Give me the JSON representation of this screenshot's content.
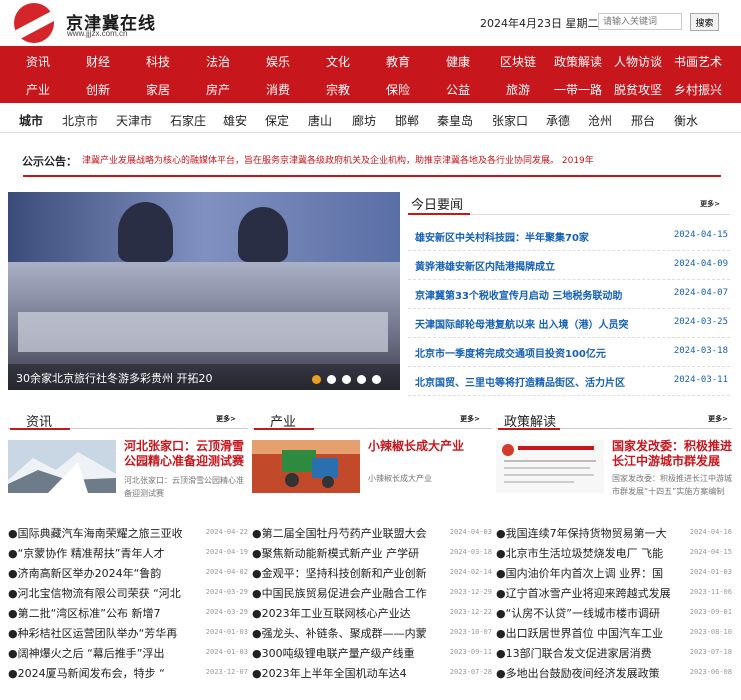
{
  "header": {
    "site_name": "京津冀在线",
    "site_url": "www.jjjzx.com.cn",
    "date": "2024年4月23日 星期二",
    "search_placeholder": "请输入关键词",
    "search_button": "搜索"
  },
  "nav": {
    "row1": [
      "资讯",
      "财经",
      "科技",
      "法治",
      "娱乐",
      "文化",
      "教育",
      "健康",
      "区块链",
      "政策解读",
      "人物访谈",
      "书画艺术"
    ],
    "row2": [
      "产业",
      "创新",
      "家居",
      "房产",
      "消费",
      "宗教",
      "保险",
      "公益",
      "旅游",
      "一带一路",
      "脱贫攻坚",
      "乡村振兴"
    ]
  },
  "cities": {
    "label": "城市",
    "items": [
      "北京市",
      "天津市",
      "石家庄",
      "雄安",
      "保定",
      "唐山",
      "廊坊",
      "邯郸",
      "秦皇岛",
      "张家口",
      "承德",
      "沧州",
      "邢台",
      "衡水"
    ]
  },
  "notice": {
    "label": "公示公告：",
    "text": "津冀产业发展战略为核心的融媒体平台，旨在服务京津冀各级政府机关及企业机构，助推京津冀各地及各行业协同发展。 2019年"
  },
  "slider": {
    "caption": "30余家北京旅行社冬游多彩贵州 开拓20",
    "dots": 5,
    "active_dot": 0
  },
  "today_news": {
    "title": "今日要闻",
    "more": "更多>",
    "items": [
      {
        "text": "雄安新区中关村科技园：半年聚集70家",
        "date": "2024-04-15"
      },
      {
        "text": "黄骅港雄安新区内陆港揭牌成立",
        "date": "2024-04-09"
      },
      {
        "text": "京津冀第33个税收宣传月启动 三地税务联动助",
        "date": "2024-04-07"
      },
      {
        "text": "天津国际邮轮母港复航以来 出入境（港）人员突",
        "date": "2024-03-25"
      },
      {
        "text": "北京市一季度将完成交通项目投资100亿元",
        "date": "2024-03-18"
      },
      {
        "text": "北京国贸、三里屯等将打造精品街区、活力片区",
        "date": "2024-03-11"
      }
    ]
  },
  "columns": [
    {
      "title": "资讯",
      "more": "更多>",
      "feature_title": "河北张家口：云顶滑雪公园精心准备迎测试赛",
      "feature_summary": "河北张家口：云顶滑雪公园精心准备迎测试赛",
      "items": [
        {
          "text": "国际典藏汽车海南荣耀之旅三亚收",
          "date": "2024-04-22"
        },
        {
          "text": "“京蒙协作 精准帮扶”青年人才",
          "date": "2024-04-19"
        },
        {
          "text": "济南高新区举办2024年“鲁韵",
          "date": "2024-04-02"
        },
        {
          "text": "河北宝信物流有限公司荣获 “河北",
          "date": "2024-03-29"
        },
        {
          "text": "第二批“湾区标准”公布 新增7",
          "date": "2024-03-29"
        },
        {
          "text": "种彩桔社区运营团队举办“芳华再",
          "date": "2024-01-03"
        },
        {
          "text": "阔神爆火之后 “幕后推手”浮出",
          "date": "2024-01-03"
        },
        {
          "text": "2024厦马新闻发布会，特步 “",
          "date": "2023-12-07"
        }
      ]
    },
    {
      "title": "产业",
      "more": "更多>",
      "feature_title": "小辣椒长成大产业",
      "feature_summary": "小辣椒长成大产业",
      "items": [
        {
          "text": "第二届全国牡丹芍药产业联盟大会",
          "date": "2024-04-03"
        },
        {
          "text": "聚焦新动能新模式新产业 产学研",
          "date": "2024-03-18"
        },
        {
          "text": "金观平：坚持科技创新和产业创新",
          "date": "2024-02-14"
        },
        {
          "text": "中国民族贸易促进会产业融合工作",
          "date": "2023-12-29"
        },
        {
          "text": "2023年工业互联网核心产业达",
          "date": "2023-12-22"
        },
        {
          "text": "强龙头、补链条、聚成群——内蒙",
          "date": "2023-10-07"
        },
        {
          "text": "300吨级锂电联产量产级产线重",
          "date": "2023-09-11"
        },
        {
          "text": "2023年上半年全国机动车达4",
          "date": "2023-07-28"
        }
      ]
    },
    {
      "title": "政策解读",
      "more": "更多>",
      "feature_title": "国家发改委：积极推进长江中游城市群发展",
      "feature_summary": "国家发改委：积极推进长江中游城市群发展“十四五”实施方案编制",
      "items": [
        {
          "text": "我国连续7年保持货物贸易第一大",
          "date": "2024-04-16"
        },
        {
          "text": "北京市生活垃圾焚烧发电厂 飞能",
          "date": "2024-04-15"
        },
        {
          "text": "国内油价年内首次上调 业界：国",
          "date": "2024-01-03"
        },
        {
          "text": "辽宁首冰雪产业将迎来跨越式发展",
          "date": "2023-11-06"
        },
        {
          "text": "“认房不认贷”一线城市楼市调研",
          "date": "2023-09-01"
        },
        {
          "text": "出口跃居世界首位 中国汽车工业",
          "date": "2023-08-10"
        },
        {
          "text": "13部门联合发文促进家居消费",
          "date": "2023-07-18"
        },
        {
          "text": "多地出台鼓励夜间经济发展政策",
          "date": "2023-06-08"
        }
      ]
    }
  ]
}
